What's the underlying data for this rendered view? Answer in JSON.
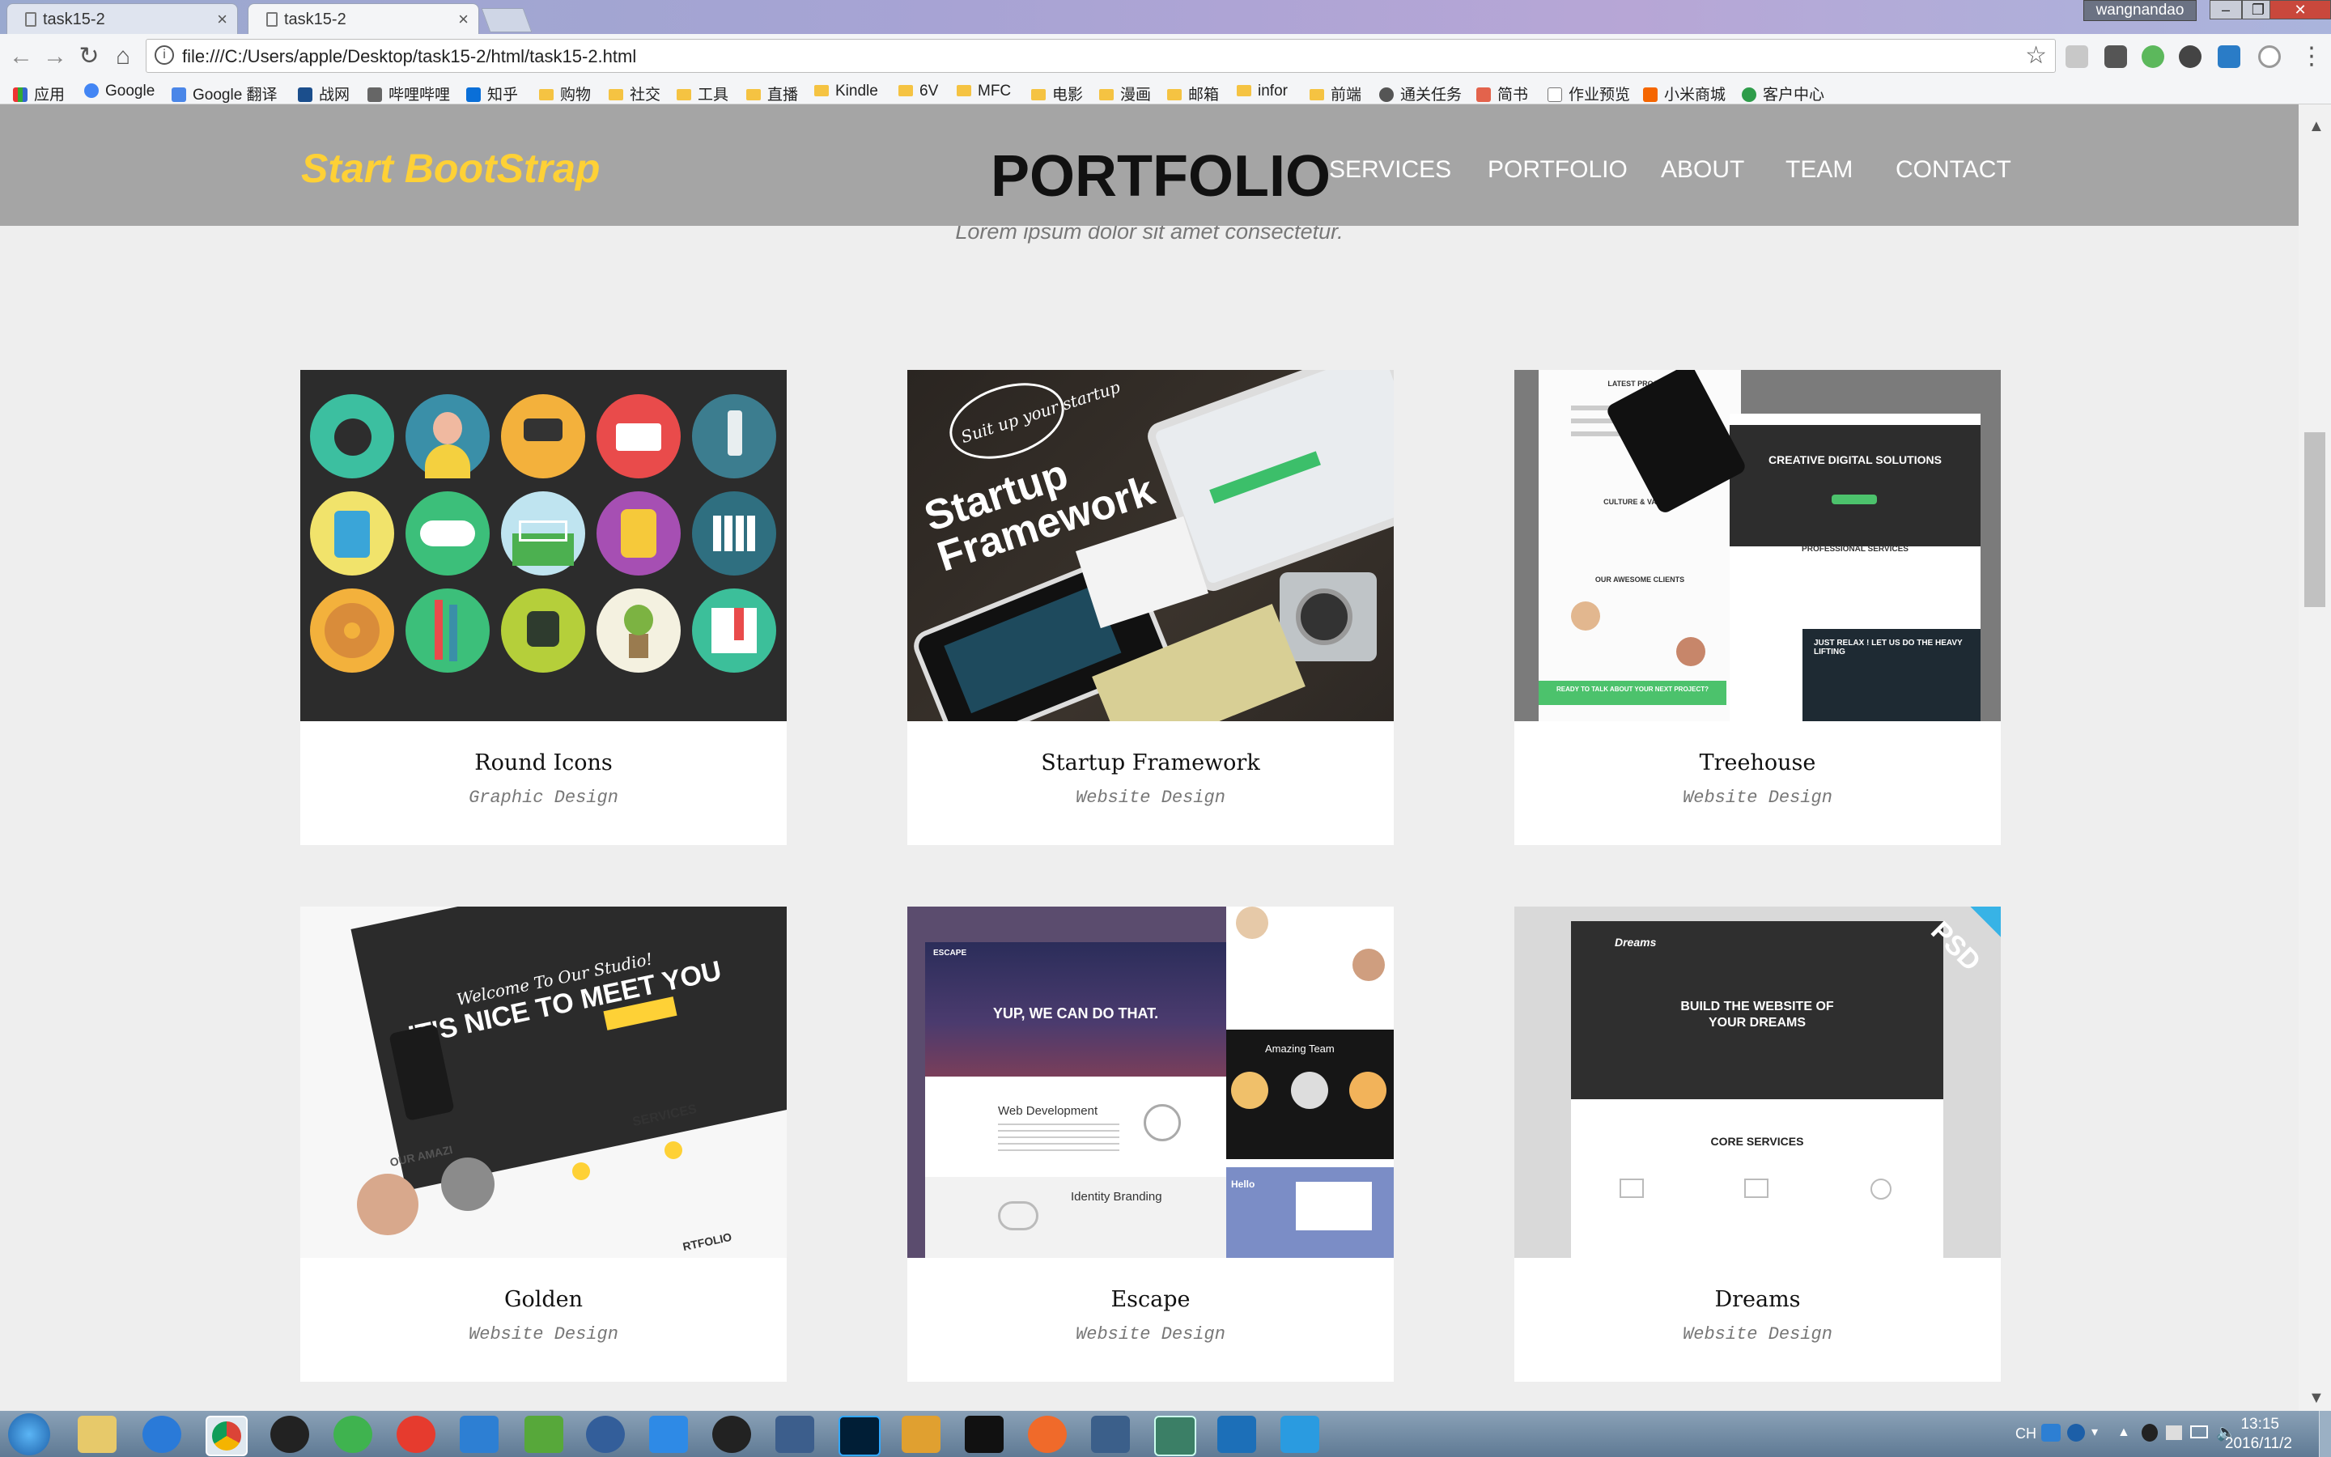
{
  "browser": {
    "tabs": [
      {
        "label": "task15-2",
        "active": false
      },
      {
        "label": "task15-2",
        "active": true
      }
    ],
    "window_user": "wangnandao",
    "address": "file:///C:/Users/apple/Desktop/task15-2/html/task15-2.html",
    "bookmarks": [
      "应用",
      "Google",
      "Google 翻译",
      "战网",
      "哔哩哔哩",
      "知乎",
      "购物",
      "社交",
      "工具",
      "直播",
      "Kindle",
      "6V",
      "MFC",
      "电影",
      "漫画",
      "邮箱",
      "infor",
      "前端",
      "通关任务",
      "简书",
      "作业预览",
      "小米商城",
      "客户中心"
    ]
  },
  "page": {
    "brand": "Start BootStrap",
    "nav": [
      "SERVICES",
      "PORTFOLIO",
      "ABOUT",
      "TEAM",
      "CONTACT"
    ],
    "section_title": "PORTFOLIO",
    "section_subtitle": "Lorem ipsum dolor sit amet consectetur.",
    "items": [
      {
        "title": "Round Icons",
        "category": "Graphic Design"
      },
      {
        "title": "Startup Framework",
        "category": "Website Design"
      },
      {
        "title": "Treehouse",
        "category": "Website Design"
      },
      {
        "title": "Golden",
        "category": "Website Design"
      },
      {
        "title": "Escape",
        "category": "Website Design"
      },
      {
        "title": "Dreams",
        "category": "Website Design"
      }
    ],
    "thumb_text": {
      "startup_badge": "Suit up your startup",
      "startup_title": "Startup Framework",
      "treehouse_latest": "LATEST PROJECT",
      "treehouse_creative": "CREATIVE DIGITAL SOLUTIONS",
      "treehouse_culture": "CULTURE & VALUES",
      "treehouse_pro": "PROFESSIONAL SERVICES",
      "treehouse_clients": "OUR AWESOME CLIENTS",
      "treehouse_relax": "JUST RELAX ! LET US DO THE HEAVY LIFTING",
      "treehouse_ready": "READY TO TALK ABOUT YOUR NEXT PROJECT?",
      "golden_welcome": "Welcome To Our Studio!",
      "golden_nice": "IT'S NICE TO MEET YOU",
      "golden_services": "SERVICES",
      "golden_amazing": "OUR AMAZI",
      "golden_portfolio": "RTFOLIO",
      "escape_logo": "ESCAPE",
      "escape_headline": "YUP, WE CAN DO THAT.",
      "escape_web": "Web Development",
      "escape_identity": "Identity Branding",
      "escape_team": "Amazing Team",
      "escape_hello": "Hello",
      "dreams_logo": "Dreams",
      "dreams_headline": "BUILD THE WEBSITE OF YOUR DREAMS",
      "dreams_core": "CORE SERVICES",
      "dreams_badge": "PSD"
    }
  },
  "taskbar": {
    "ime": "CH",
    "time": "13:15",
    "date": "2016/11/2"
  },
  "colors": {
    "brand_yellow": "#fed136",
    "navbar_gray": "#a5a5a5",
    "page_bg": "#eeeeee"
  }
}
